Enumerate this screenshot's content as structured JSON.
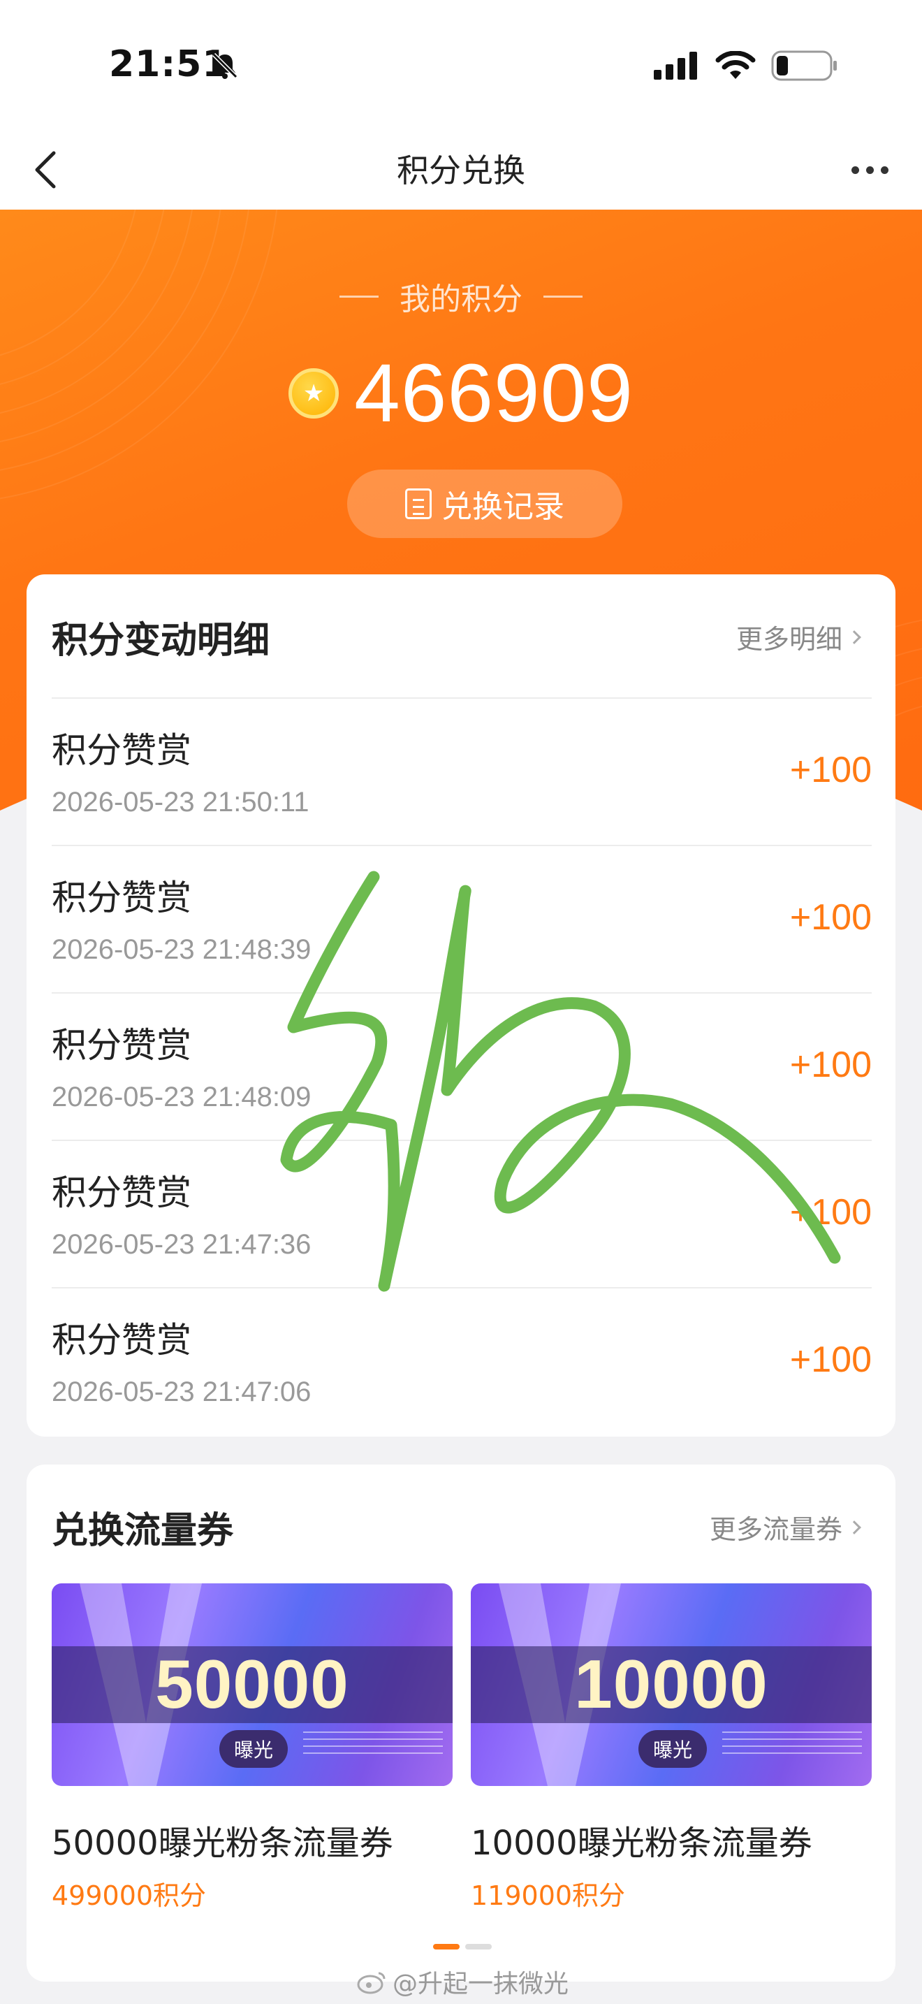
{
  "status_bar": {
    "time": "21:51",
    "icons": [
      "bell-slash-icon",
      "signal-icon",
      "wifi-icon",
      "battery-icon"
    ]
  },
  "nav": {
    "title": "积分兑换",
    "back_icon": "chevron-left-icon",
    "more_icon": "more-dots-icon"
  },
  "hero": {
    "label": "我的积分",
    "points": "466909",
    "coin_icon": "coin-star-icon",
    "record_button": "兑换记录"
  },
  "details": {
    "title": "积分变动明细",
    "more": "更多明细",
    "rows": [
      {
        "name": "积分赞赏",
        "time": "2026-05-23 21:50:11",
        "amount": "+100"
      },
      {
        "name": "积分赞赏",
        "time": "2026-05-23 21:48:39",
        "amount": "+100"
      },
      {
        "name": "积分赞赏",
        "time": "2026-05-23 21:48:09",
        "amount": "+100"
      },
      {
        "name": "积分赞赏",
        "time": "2026-05-23 21:47:36",
        "amount": "+100"
      },
      {
        "name": "积分赞赏",
        "time": "2026-05-23 21:47:06",
        "amount": "+100"
      }
    ]
  },
  "coupons": {
    "title": "兑换流量券",
    "more": "更多流量券",
    "items": [
      {
        "amount": "50000",
        "badge": "曝光",
        "name": "50000曝光粉条流量券",
        "price": "499000积分"
      },
      {
        "amount": "10000",
        "badge": "曝光",
        "name": "10000曝光粉条流量券",
        "price": "119000积分"
      }
    ]
  },
  "watermark": "@升起一抹微光",
  "colors": {
    "accent": "#ff7a13",
    "hero_gradient_start": "#ff8a1a",
    "hero_gradient_end": "#ff6a10",
    "doodle": "#6dbb4f"
  }
}
